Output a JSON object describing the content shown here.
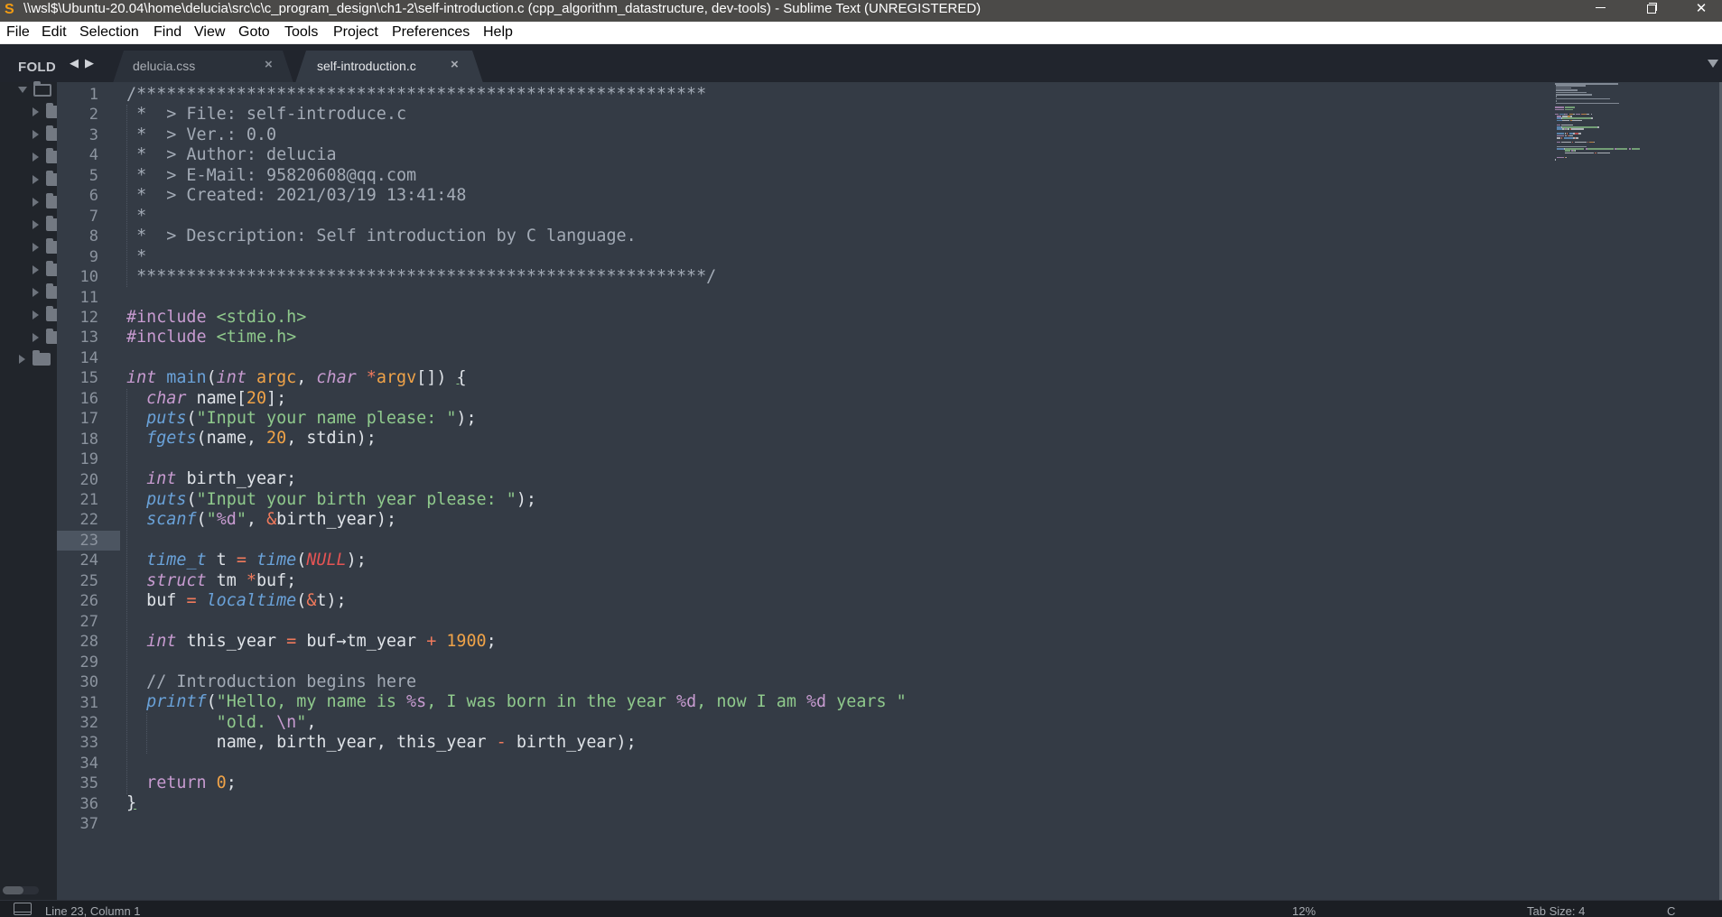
{
  "window": {
    "title": "\\\\wsl$\\Ubuntu-20.04\\home\\delucia\\src\\c\\c_program_design\\ch1-2\\self-introduction.c (cpp_algorithm_datastructure, dev-tools) - Sublime Text (UNREGISTERED)",
    "app_icon": "S",
    "controls": {
      "minimize": "minimize-icon",
      "maximize": "restore-icon",
      "close": "✕"
    }
  },
  "menu": [
    "File",
    "Edit",
    "Selection",
    "Find",
    "View",
    "Goto",
    "Tools",
    "Project",
    "Preferences",
    "Help"
  ],
  "sidebar": {
    "title": "FOLDERS",
    "nav_back": "◀",
    "nav_forward": "▶",
    "root_folder_expanded": true,
    "subfolders_count": 11,
    "second_root_collapsed": true
  },
  "tabs": [
    {
      "label": "delucia.css",
      "close": "×",
      "active": false
    },
    {
      "label": "self-introduction.c",
      "close": "×",
      "active": true
    }
  ],
  "editor": {
    "active_line": 23,
    "line_numbers": [
      "1",
      "2",
      "3",
      "4",
      "5",
      "6",
      "7",
      "8",
      "9",
      "10",
      "11",
      "12",
      "13",
      "14",
      "15",
      "16",
      "17",
      "18",
      "19",
      "20",
      "21",
      "22",
      "23",
      "24",
      "25",
      "26",
      "27",
      "28",
      "29",
      "30",
      "31",
      "32",
      "33",
      "34",
      "35",
      "36",
      "37"
    ],
    "lines": [
      [
        [
          "c-comment",
          "/*********************************************************"
        ]
      ],
      [
        [
          "c-comment",
          " *  > File: self-introduce.c"
        ]
      ],
      [
        [
          "c-comment",
          " *  > Ver.: 0.0"
        ]
      ],
      [
        [
          "c-comment",
          " *  > Author: delucia"
        ]
      ],
      [
        [
          "c-comment",
          " *  > E-Mail: 95820608@qq.com"
        ]
      ],
      [
        [
          "c-comment",
          " *  > Created: 2021/03/19 13:41:48"
        ]
      ],
      [
        [
          "c-comment",
          " *"
        ]
      ],
      [
        [
          "c-comment",
          " *  > Description: Self introduction by C language."
        ]
      ],
      [
        [
          "c-comment",
          " *"
        ]
      ],
      [
        [
          "c-comment",
          " *********************************************************/"
        ]
      ],
      [],
      [
        [
          "c-pre",
          "#include "
        ],
        [
          "c-header",
          "<stdio.h>"
        ]
      ],
      [
        [
          "c-pre",
          "#include "
        ],
        [
          "c-header",
          "<time.h>"
        ]
      ],
      [],
      [
        [
          "c-type",
          "int"
        ],
        [
          "c-punct",
          " "
        ],
        [
          "c-func",
          "main"
        ],
        [
          "c-punct",
          "("
        ],
        [
          "c-type",
          "int"
        ],
        [
          "c-punct",
          " "
        ],
        [
          "c-param",
          "argc"
        ],
        [
          "c-punct",
          ", "
        ],
        [
          "c-type",
          "char"
        ],
        [
          "c-punct",
          " "
        ],
        [
          "c-op",
          "*"
        ],
        [
          "c-param",
          "argv"
        ],
        [
          "c-punct",
          "[]) "
        ],
        [
          "c-punct c-brace-ul",
          "{"
        ]
      ],
      [
        [
          "c-punct",
          "  "
        ],
        [
          "c-type",
          "char"
        ],
        [
          "c-punct",
          " name["
        ],
        [
          "c-num",
          "20"
        ],
        [
          "c-punct",
          "];"
        ]
      ],
      [
        [
          "c-punct",
          "  "
        ],
        [
          "c-func-i",
          "puts"
        ],
        [
          "c-punct",
          "("
        ],
        [
          "c-str",
          "\"Input your name please: \""
        ],
        [
          "c-punct",
          ");"
        ]
      ],
      [
        [
          "c-punct",
          "  "
        ],
        [
          "c-func-i",
          "fgets"
        ],
        [
          "c-punct",
          "(name, "
        ],
        [
          "c-num",
          "20"
        ],
        [
          "c-punct",
          ", stdin);"
        ]
      ],
      [],
      [
        [
          "c-punct",
          "  "
        ],
        [
          "c-type",
          "int"
        ],
        [
          "c-punct",
          " birth_year;"
        ]
      ],
      [
        [
          "c-punct",
          "  "
        ],
        [
          "c-func-i",
          "puts"
        ],
        [
          "c-punct",
          "("
        ],
        [
          "c-str",
          "\"Input your birth year please: \""
        ],
        [
          "c-punct",
          ");"
        ]
      ],
      [
        [
          "c-punct",
          "  "
        ],
        [
          "c-func-i",
          "scanf"
        ],
        [
          "c-punct",
          "("
        ],
        [
          "c-str",
          "\""
        ],
        [
          "c-fmt",
          "%d"
        ],
        [
          "c-str",
          "\""
        ],
        [
          "c-punct",
          ", "
        ],
        [
          "c-op",
          "&"
        ],
        [
          "c-punct",
          "birth_year);"
        ]
      ],
      [],
      [
        [
          "c-punct",
          "  "
        ],
        [
          "c-func-i",
          "time_t"
        ],
        [
          "c-punct",
          " t "
        ],
        [
          "c-op",
          "="
        ],
        [
          "c-punct",
          " "
        ],
        [
          "c-func-i",
          "time"
        ],
        [
          "c-punct",
          "("
        ],
        [
          "c-null",
          "NULL"
        ],
        [
          "c-punct",
          ");"
        ]
      ],
      [
        [
          "c-punct",
          "  "
        ],
        [
          "c-type",
          "struct"
        ],
        [
          "c-punct",
          " tm "
        ],
        [
          "c-op",
          "*"
        ],
        [
          "c-punct",
          "buf;"
        ]
      ],
      [
        [
          "c-punct",
          "  buf "
        ],
        [
          "c-op",
          "="
        ],
        [
          "c-punct",
          " "
        ],
        [
          "c-func-i",
          "localtime"
        ],
        [
          "c-punct",
          "("
        ],
        [
          "c-op",
          "&"
        ],
        [
          "c-punct",
          "t);"
        ]
      ],
      [],
      [
        [
          "c-punct",
          "  "
        ],
        [
          "c-type",
          "int"
        ],
        [
          "c-punct",
          " this_year "
        ],
        [
          "c-op",
          "="
        ],
        [
          "c-punct",
          " buf→tm_year "
        ],
        [
          "c-op",
          "+"
        ],
        [
          "c-punct",
          " "
        ],
        [
          "c-num",
          "1900"
        ],
        [
          "c-punct",
          ";"
        ]
      ],
      [],
      [
        [
          "c-punct",
          "  "
        ],
        [
          "c-comment",
          "// Introduction begins here"
        ]
      ],
      [
        [
          "c-punct",
          "  "
        ],
        [
          "c-func-i",
          "printf"
        ],
        [
          "c-punct",
          "("
        ],
        [
          "c-str",
          "\"Hello, my name is "
        ],
        [
          "c-fmt",
          "%s"
        ],
        [
          "c-str",
          ", I was born in the year "
        ],
        [
          "c-fmt",
          "%d"
        ],
        [
          "c-str",
          ", now I am "
        ],
        [
          "c-fmt",
          "%d"
        ],
        [
          "c-str",
          " years \""
        ]
      ],
      [
        [
          "c-punct",
          "         "
        ],
        [
          "c-str",
          "\"old. "
        ],
        [
          "c-fmt",
          "\\n"
        ],
        [
          "c-str",
          "\""
        ],
        [
          "c-punct",
          ","
        ]
      ],
      [
        [
          "c-punct",
          "         name, birth_year, this_year "
        ],
        [
          "c-op",
          "-"
        ],
        [
          "c-punct",
          " birth_year);"
        ]
      ],
      [],
      [
        [
          "c-punct",
          "  "
        ],
        [
          "c-kw",
          "return"
        ],
        [
          "c-punct",
          " "
        ],
        [
          "c-num",
          "0"
        ],
        [
          "c-punct",
          ";"
        ]
      ],
      [
        [
          "c-punct c-brace-ul",
          "}"
        ]
      ],
      []
    ]
  },
  "status": {
    "position": "Line 23, Column 1",
    "zoom": "12%",
    "tab_size": "Tab Size: 4",
    "syntax": "C"
  },
  "colors": {
    "editor_bg": "#343b45",
    "sidebar_bg": "#21252b",
    "titlebar_bg": "#4b4a48",
    "statusbar_bg": "#1b1e23"
  }
}
